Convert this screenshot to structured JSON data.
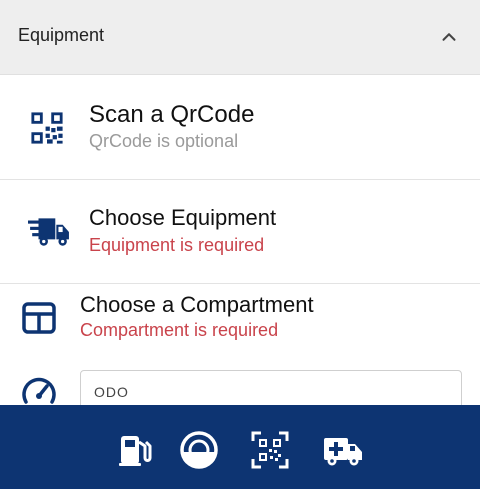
{
  "header": {
    "title": "Equipment",
    "chevron_icon": "chevron-up-icon"
  },
  "rows": [
    {
      "title": "Scan a QrCode",
      "subtitle": "QrCode is optional",
      "icon": "qrcode-icon"
    },
    {
      "title": "Choose Equipment",
      "subtitle": "Equipment is required",
      "icon": "truck-icon"
    },
    {
      "title": "Choose a Compartment",
      "subtitle": "Compartment is required",
      "icon": "compartment-grid-icon"
    }
  ],
  "odo": {
    "placeholder": "ODO",
    "icon": "speedometer-icon"
  },
  "bottom_nav": [
    {
      "icon": "fuel-pump-icon"
    },
    {
      "icon": "tire-icon"
    },
    {
      "icon": "qr-scan-icon"
    },
    {
      "icon": "ambulance-icon"
    }
  ],
  "colors": {
    "primary": "#0d3472",
    "error": "#c9434b",
    "hint": "#9a9a9a",
    "header_bg": "#eeeeee"
  }
}
